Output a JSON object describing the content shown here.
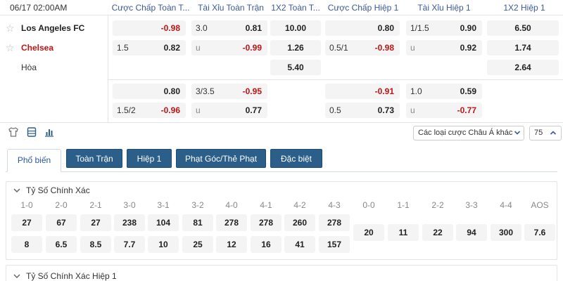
{
  "header": {
    "time": "06/17 02:00AM",
    "col1": "Cược Chấp Toàn T...",
    "col2": "Tài Xỉu Toàn Trận",
    "col3": "1X2 Toàn T...",
    "col4": "Cược Chấp Hiệp 1",
    "col5": "Tài Xỉu Hiệp 1",
    "col6": "1X2 Hiệp 1"
  },
  "teams": {
    "home": "Los Angeles FC",
    "away": "Chelsea",
    "draw": "Hòa"
  },
  "markets": {
    "row1": {
      "ah_ft_price": "-0.98",
      "ou_ft_line": "3.0",
      "ou_ft_price": "0.81",
      "x12_ft": "10.00",
      "ah_h1_price": "0.80",
      "ou_h1_line": "1/1.5",
      "ou_h1_price": "0.90",
      "x12_h1": "6.50"
    },
    "row2": {
      "ah_ft_line": "1.5",
      "ah_ft_price": "0.82",
      "ou_ft_line": "u",
      "ou_ft_price": "-0.99",
      "x12_ft": "1.26",
      "ah_h1_line": "0.5/1",
      "ah_h1_price": "-0.98",
      "ou_h1_line": "u",
      "ou_h1_price": "0.92",
      "x12_h1": "1.74"
    },
    "row3": {
      "x12_ft": "5.40",
      "x12_h1": "2.64"
    },
    "alt1": {
      "ah_ft_price": "0.80",
      "ou_ft_line": "3/3.5",
      "ou_ft_price": "-0.95",
      "ah_h1_price": "-0.91",
      "ou_h1_line": "1.0",
      "ou_h1_price": "0.59"
    },
    "alt2": {
      "ah_ft_line": "1.5/2",
      "ah_ft_price": "-0.96",
      "ou_ft_line": "u",
      "ou_ft_price": "0.77",
      "ah_h1_line": "0.5",
      "ah_h1_price": "0.73",
      "ou_h1_line": "u",
      "ou_h1_price": "-0.77"
    }
  },
  "toolbar": {
    "selector_label": "Các loại cược Châu Á khác",
    "count": "75"
  },
  "tabs": [
    "Phổ biến",
    "Toàn Trận",
    "Hiệp 1",
    "Phạt Góc/Thẻ Phạt",
    "Đặc biệt"
  ],
  "correct_score": {
    "title": "Tỷ Số Chính Xác",
    "home_scores": [
      "1-0",
      "2-0",
      "2-1",
      "3-0",
      "3-1",
      "3-2",
      "4-0",
      "4-1",
      "4-2",
      "4-3"
    ],
    "home_odds": [
      "27",
      "67",
      "27",
      "238",
      "104",
      "81",
      "278",
      "278",
      "260",
      "278"
    ],
    "away_odds": [
      "8",
      "6.5",
      "8.5",
      "7.7",
      "10",
      "25",
      "12",
      "16",
      "41",
      "157"
    ],
    "draw_scores": [
      "0-0",
      "1-1",
      "2-2",
      "3-3",
      "4-4",
      "AOS"
    ],
    "draw_odds": [
      "20",
      "11",
      "22",
      "94",
      "300",
      "7.6"
    ]
  },
  "correct_score_h1": {
    "title": "Tỷ Số Chính Xác Hiệp 1"
  },
  "colors": {
    "accent": "#2b5f8a",
    "negative": "#c21414",
    "header_text": "#3b5a9a"
  }
}
